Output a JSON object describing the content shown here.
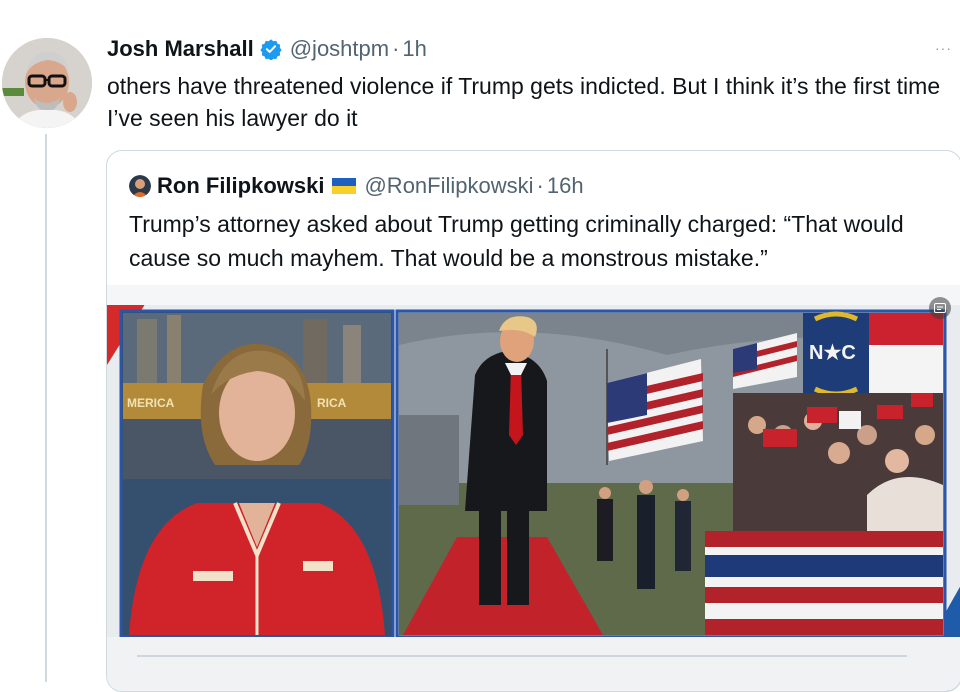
{
  "tweet": {
    "author_name": "Josh Marshall",
    "handle": "@joshtpm",
    "separator": "·",
    "time": "1h",
    "more": "···",
    "text": "others have threatened violence if Trump gets indicted. But I think it’s the first time I’ve seen his lawyer do it",
    "verified_icon": "verified-badge-icon",
    "accent_color": "#1d9bf0"
  },
  "quote": {
    "author_name": "Ron Filipkowski",
    "flag_icon": "ukraine-flag-icon",
    "handle": "@RonFilipkowski",
    "separator": "·",
    "time": "16h",
    "text": "Trump’s attorney asked about Trump getting criminally charged: “That would cause so much mayhem. That would be a monstrous mistake.”",
    "media_badge_icon": "caption-icon",
    "media": {
      "sign_text": "N★C",
      "left_ticker": "MERICA",
      "right_ticker": "RICA"
    }
  }
}
